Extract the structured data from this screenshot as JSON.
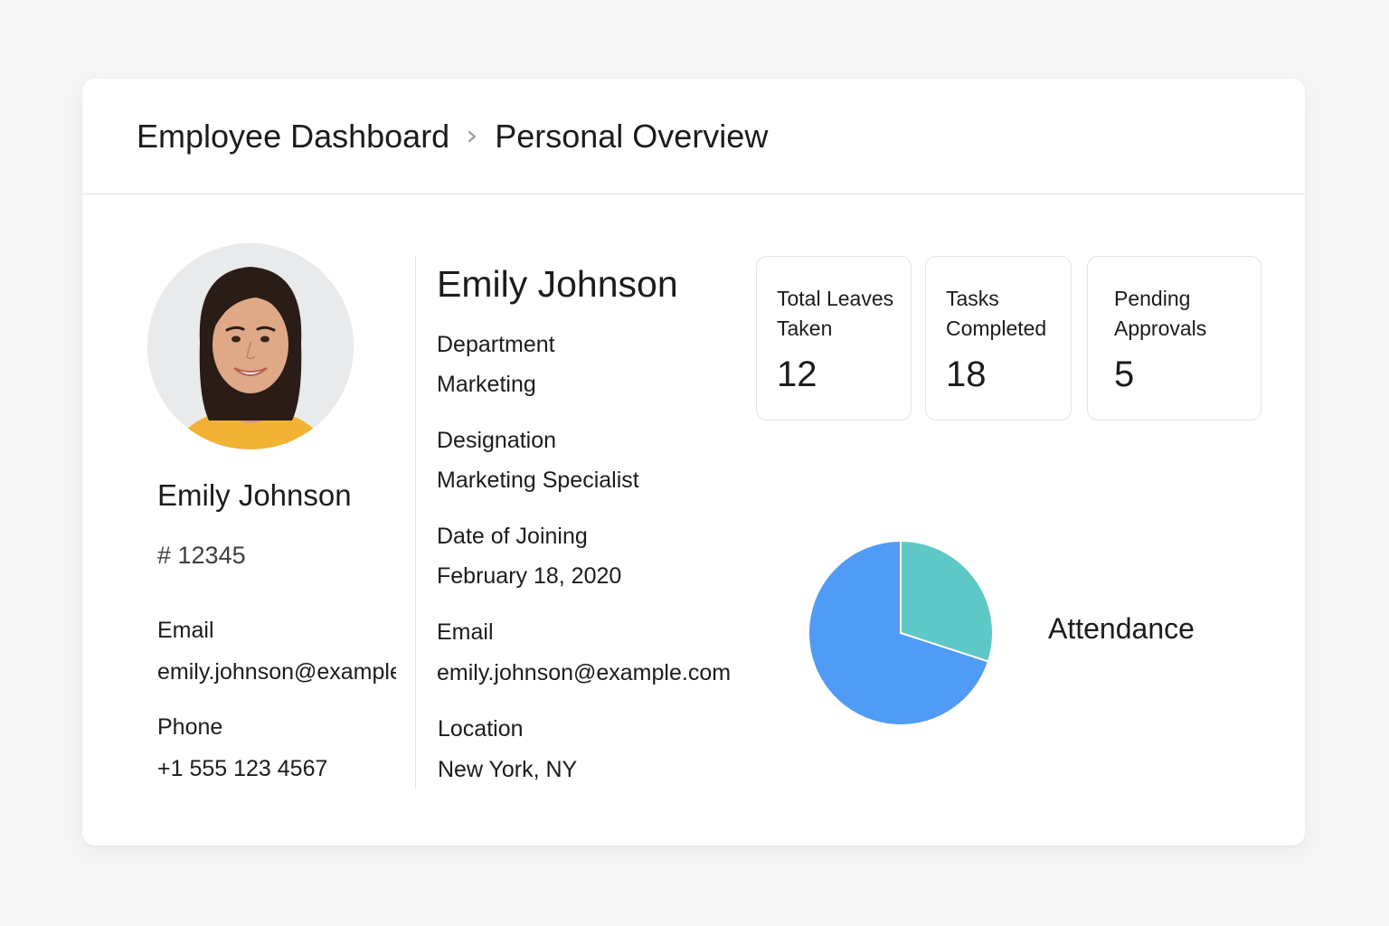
{
  "breadcrumb": {
    "root": "Employee Dashboard",
    "current": "Personal Overview"
  },
  "profile": {
    "name": "Emily Johnson",
    "employee_id": "# 12345",
    "email_label": "Email",
    "email": "emily.johnson@example.com",
    "phone_label": "Phone",
    "phone": "+1 555 123 4567"
  },
  "details": {
    "name": "Emily Johnson",
    "department_label": "Department",
    "department": "Marketing",
    "designation_label": "Designation",
    "designation": "Marketing Specialist",
    "doj_label": "Date of Joining",
    "doj": "February 18, 2020",
    "email_label": "Email",
    "email": "emily.johnson@example.com",
    "location_label": "Location",
    "location": "New York, NY"
  },
  "stats": [
    {
      "label": "Total Leaves Taken",
      "value": "12"
    },
    {
      "label": "Tasks Completed",
      "value": "18"
    },
    {
      "label": "Pending Approvals",
      "value": "5"
    }
  ],
  "attendance": {
    "label": "Attendance",
    "colors": {
      "present": "#4f9bf5",
      "absent": "#5ec8c6"
    }
  },
  "chart_data": {
    "type": "pie",
    "title": "Attendance",
    "values": [
      70,
      30
    ],
    "colors": [
      "#4f9bf5",
      "#5ec8c6"
    ]
  },
  "icons": {
    "breadcrumb_separator": "chevron-right-icon",
    "avatar": "employee-photo"
  }
}
